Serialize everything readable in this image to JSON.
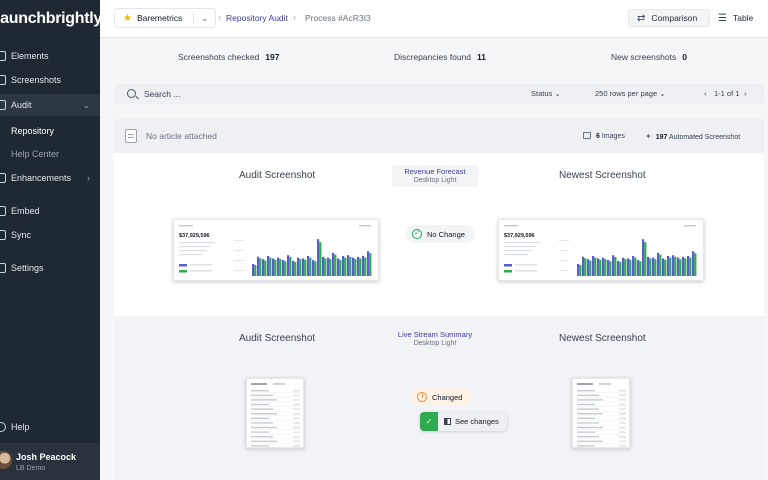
{
  "brand": {
    "logo_text": "launchbrightly"
  },
  "sidebar": {
    "items": [
      {
        "label": "Elements"
      },
      {
        "label": "Screenshots"
      },
      {
        "label": "Audit"
      },
      {
        "label": "Enhancements"
      },
      {
        "label": "Embed"
      },
      {
        "label": "Sync"
      },
      {
        "label": "Settings"
      }
    ],
    "sub_items": [
      {
        "label": "Repository"
      },
      {
        "label": "Help Center"
      }
    ],
    "help_label": "Help",
    "user": {
      "name": "Josh Peacock",
      "org": "LB Demo"
    }
  },
  "header": {
    "project": "Baremetrics",
    "breadcrumb": [
      "Repository Audit",
      "Process #AcR3I3"
    ],
    "views": [
      {
        "label": "Comparison"
      },
      {
        "label": "Table"
      }
    ]
  },
  "stats": [
    {
      "label": "Screenshots checked",
      "value": "197"
    },
    {
      "label": "Discrepancies found",
      "value": "11"
    },
    {
      "label": "New screenshots",
      "value": "0"
    }
  ],
  "search": {
    "placeholder": "Search ...",
    "status_label": "Status",
    "rows_label": "250 rows per page",
    "pagination": "1-1 of 1"
  },
  "article": {
    "text": "No article attached",
    "images_count": "6",
    "images_label": "Images",
    "automated_count": "197",
    "automated_label": "Automated Screenshot"
  },
  "comparisons": [
    {
      "left_title": "Audit Screenshot",
      "right_title": "Newest Screenshot",
      "story": "Revenue Forecast",
      "variant": "Desktop Light",
      "status": "No Change",
      "mini_value": "$37,929,596",
      "bars": [
        30,
        48,
        42,
        50,
        44,
        46,
        40,
        52,
        38,
        46,
        44,
        50,
        40,
        92,
        48,
        46,
        58,
        44,
        50,
        52,
        46,
        48,
        50,
        62
      ]
    },
    {
      "left_title": "Audit Screenshot",
      "right_title": "Newest Screenshot",
      "story": "Live Stream Summary",
      "variant": "Desktop Light",
      "status": "Changed",
      "action": "See changes"
    }
  ],
  "colors": {
    "sidebar": "#1f2933",
    "accent": "#3b3b9e",
    "bar_primary": "#5b5bd6",
    "bar_secondary": "#2eaa4f"
  }
}
